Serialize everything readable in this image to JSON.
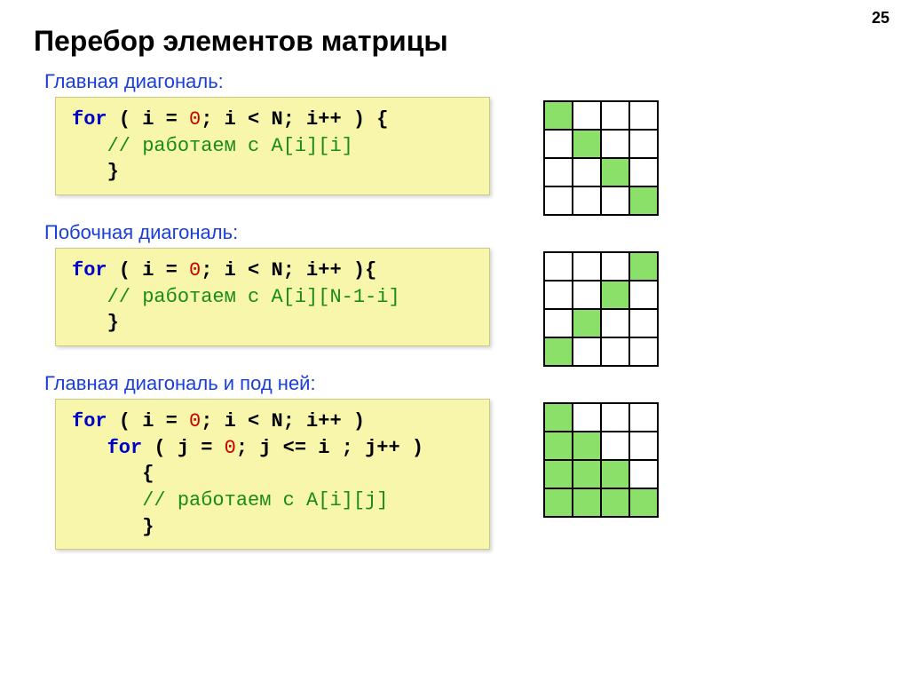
{
  "page_number": "25",
  "title": "Перебор элементов матрицы",
  "sections": [
    {
      "label": "Главная диагональ:",
      "code_html": "<span class='kw'>for</span><span class='punct'> ( i = </span><span class='num'>0</span><span class='punct'>; i &lt; N; i++ ) {</span>\n   <span class='cmt'>// работаем с A[i][i]</span>\n   <span class='punct'>}</span>",
      "grid": [
        [
          1,
          0,
          0,
          0
        ],
        [
          0,
          1,
          0,
          0
        ],
        [
          0,
          0,
          1,
          0
        ],
        [
          0,
          0,
          0,
          1
        ]
      ]
    },
    {
      "label": "Побочная диагональ:",
      "code_html": "<span class='kw'>for</span><span class='punct'> ( i = </span><span class='num'>0</span><span class='punct'>; i &lt; N; i++ ){</span>\n   <span class='cmt'>// работаем с A[i][N-1-i]</span>\n   <span class='punct'>}</span>",
      "grid": [
        [
          0,
          0,
          0,
          1
        ],
        [
          0,
          0,
          1,
          0
        ],
        [
          0,
          1,
          0,
          0
        ],
        [
          1,
          0,
          0,
          0
        ]
      ]
    },
    {
      "label": "Главная диагональ и под ней:",
      "code_html": "<span class='kw'>for</span><span class='punct'> ( i = </span><span class='num'>0</span><span class='punct'>; i &lt; N; i++ )</span>\n   <span class='kw'>for</span><span class='punct'> ( j = </span><span class='num'>0</span><span class='punct'>; j &lt;= i ; j++ )</span>\n      <span class='punct'>{</span>\n      <span class='cmt'>// работаем с A[i][j]</span>\n      <span class='punct'>}</span>",
      "grid": [
        [
          1,
          0,
          0,
          0
        ],
        [
          1,
          1,
          0,
          0
        ],
        [
          1,
          1,
          1,
          0
        ],
        [
          1,
          1,
          1,
          1
        ]
      ]
    }
  ]
}
